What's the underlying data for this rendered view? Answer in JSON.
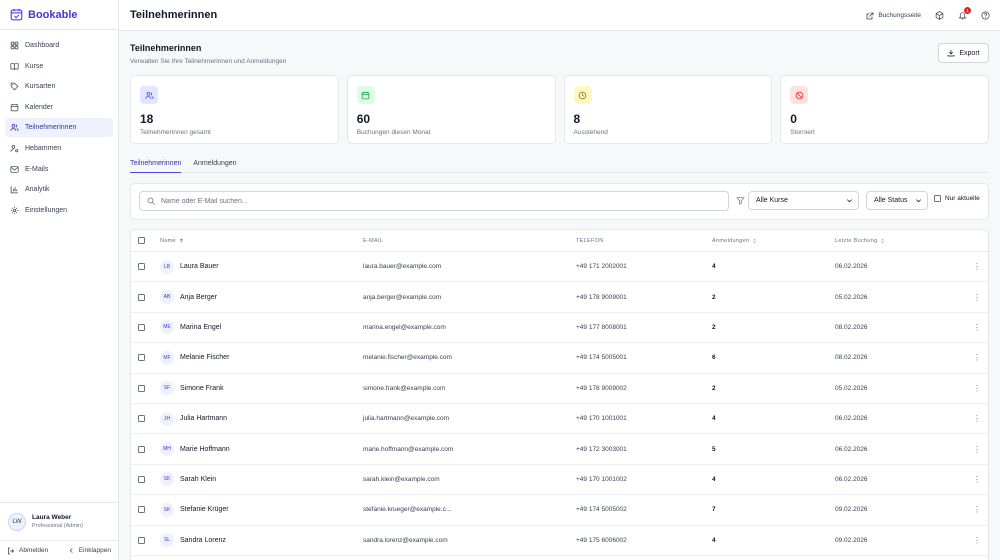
{
  "app": {
    "name": "Bookable"
  },
  "sidebar": {
    "items": [
      {
        "label": "Dashboard",
        "icon": "grid-icon",
        "active": false
      },
      {
        "label": "Kurse",
        "icon": "book-icon",
        "active": false
      },
      {
        "label": "Kursarten",
        "icon": "tag-icon",
        "active": false
      },
      {
        "label": "Kalender",
        "icon": "calendar-icon",
        "active": false
      },
      {
        "label": "Teilnehmerinnen",
        "icon": "users-icon",
        "active": true
      },
      {
        "label": "Hebammen",
        "icon": "user-cog-icon",
        "active": false
      },
      {
        "label": "E-Mails",
        "icon": "mail-icon",
        "active": false
      },
      {
        "label": "Analytik",
        "icon": "bar-chart-icon",
        "active": false
      },
      {
        "label": "Einstellungen",
        "icon": "gear-icon",
        "active": false
      }
    ],
    "user": {
      "initials": "LW",
      "name": "Laura Weber",
      "role": "Professional (Admin)"
    },
    "logout_label": "Abmelden",
    "collapse_label": "Einklappen"
  },
  "topbar": {
    "title": "Teilnehmerinnen",
    "booking_link": "Buchungsseite",
    "notification_count": "1"
  },
  "page": {
    "title": "Teilnehmerinnen",
    "subtitle": "Verwalten Sie Ihre Teilnehmerinnen und Anmeldungen",
    "export_label": "Export"
  },
  "stats": [
    {
      "value": "18",
      "label": "Teilnehmerinnen gesamt",
      "color": "#e0e7ff",
      "icon_color": "#4f46e5"
    },
    {
      "value": "60",
      "label": "Buchungen diesen Monat",
      "color": "#dcfce7",
      "icon_color": "#16a34a"
    },
    {
      "value": "8",
      "label": "Ausstehend",
      "color": "#fef9c3",
      "icon_color": "#a16207"
    },
    {
      "value": "0",
      "label": "Storniert",
      "color": "#fee2e2",
      "icon_color": "#dc2626"
    }
  ],
  "tabs": [
    {
      "label": "Teilnehmerinnen",
      "active": true
    },
    {
      "label": "Anmeldungen",
      "active": false
    }
  ],
  "filters": {
    "search_placeholder": "Name oder E-Mail suchen...",
    "course_select": "Alle Kurse",
    "status_select": "Alle Status",
    "only_current_label": "Nur aktuelle"
  },
  "table": {
    "headers": {
      "name": "Name",
      "email": "E-MAIL",
      "phone": "TELEFON",
      "registrations": "Anmeldungen",
      "last_booking": "Letzte Buchung"
    },
    "rows": [
      {
        "initials": "LB",
        "name": "Laura Bauer",
        "email": "laura.bauer@example.com",
        "phone": "+49 171 2002001",
        "registrations": "4",
        "last_booking": "06.02.2026"
      },
      {
        "initials": "AB",
        "name": "Anja Berger",
        "email": "anja.berger@example.com",
        "phone": "+49 178 9009001",
        "registrations": "2",
        "last_booking": "05.02.2026"
      },
      {
        "initials": "ME",
        "name": "Marina Engel",
        "email": "marina.engel@example.com",
        "phone": "+49 177 8008001",
        "registrations": "2",
        "last_booking": "08.02.2026"
      },
      {
        "initials": "MF",
        "name": "Melanie Fischer",
        "email": "melanie.fischer@example.com",
        "phone": "+49 174 5005001",
        "registrations": "6",
        "last_booking": "08.02.2026"
      },
      {
        "initials": "SF",
        "name": "Simone Frank",
        "email": "simone.frank@example.com",
        "phone": "+49 178 9009002",
        "registrations": "2",
        "last_booking": "05.02.2026"
      },
      {
        "initials": "JH",
        "name": "Julia Hartmann",
        "email": "julia.hartmann@example.com",
        "phone": "+49 170 1001001",
        "registrations": "4",
        "last_booking": "06.02.2026"
      },
      {
        "initials": "MH",
        "name": "Marie Hoffmann",
        "email": "marie.hoffmann@example.com",
        "phone": "+49 172 3003001",
        "registrations": "5",
        "last_booking": "06.02.2026"
      },
      {
        "initials": "SK",
        "name": "Sarah Klein",
        "email": "sarah.klein@example.com",
        "phone": "+49 170 1001002",
        "registrations": "4",
        "last_booking": "06.02.2026"
      },
      {
        "initials": "SK",
        "name": "Stefanie Krüger",
        "email": "stefanie.krueger@example.c...",
        "phone": "+49 174 5005002",
        "registrations": "7",
        "last_booking": "09.02.2026"
      },
      {
        "initials": "SL",
        "name": "Sandra Lorenz",
        "email": "sandra.lorenz@example.com",
        "phone": "+49 175 6006002",
        "registrations": "4",
        "last_booking": "09.02.2026"
      }
    ]
  }
}
